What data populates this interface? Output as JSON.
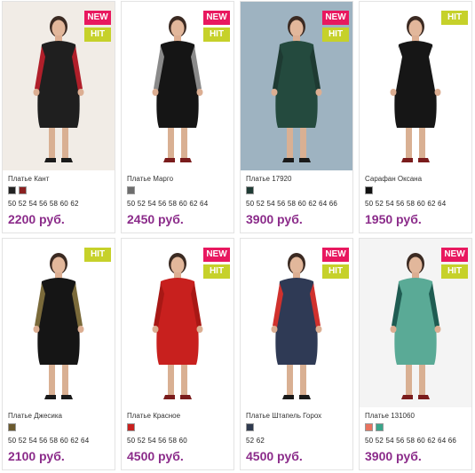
{
  "accent_price_color": "#8b2b8a",
  "badge_colors": {
    "new": "#e8185f",
    "hit": "#c6d12a"
  },
  "products": [
    {
      "name": "Платье Кант",
      "badges": [
        "NEW",
        "HIT"
      ],
      "swatches": [
        "#222222",
        "#8a2020"
      ],
      "sizes": "50 52 54 56 58 60 62",
      "price": "2200 руб.",
      "dress": "#1f1f1f",
      "accent": "#b01f2a",
      "bg": "#f1ece6"
    },
    {
      "name": "Платье Марго",
      "badges": [
        "NEW",
        "HIT"
      ],
      "swatches": [
        "#6d6d6d"
      ],
      "sizes": "50 52 54 56 58 60 62 64",
      "price": "2450 руб.",
      "dress": "#151515",
      "accent": "#8a8a8a",
      "bg": "#ffffff"
    },
    {
      "name": "Платье 17920",
      "badges": [
        "NEW",
        "HIT"
      ],
      "swatches": [
        "#1f3b34"
      ],
      "sizes": "50 52 54 56 58 60 62 64 66",
      "price": "3900 руб.",
      "dress": "#244a3e",
      "accent": "#1e3a32",
      "bg": "#9eb3c1"
    },
    {
      "name": "Сарафан Оксана",
      "badges": [
        "HIT"
      ],
      "swatches": [
        "#111111"
      ],
      "sizes": "50 52 54 56 58 60 62 64",
      "price": "1950 руб.",
      "dress": "#161616",
      "accent": "#ffffff",
      "bg": "#ffffff"
    },
    {
      "name": "Платье Джесика",
      "badges": [
        "HIT"
      ],
      "swatches": [
        "#6b5a2f"
      ],
      "sizes": "50 52 54 56 58 60 62 64",
      "price": "2100 руб.",
      "dress": "#151515",
      "accent": "#7a6a3a",
      "bg": "#ffffff"
    },
    {
      "name": "Платье Красное",
      "badges": [
        "NEW",
        "HIT"
      ],
      "swatches": [
        "#c8201e"
      ],
      "sizes": "50 52 54 56 58 60",
      "price": "4500 руб.",
      "dress": "#c8201e",
      "accent": "#a81815",
      "bg": "#ffffff"
    },
    {
      "name": "Платье Штапель Горох",
      "badges": [
        "NEW",
        "HIT"
      ],
      "swatches": [
        "#2f3a4f"
      ],
      "sizes": "52 62",
      "price": "4500 руб.",
      "dress": "#2f3a55",
      "accent": "#d0312d",
      "bg": "#ffffff"
    },
    {
      "name": "Платье 131060",
      "badges": [
        "NEW",
        "HIT"
      ],
      "swatches": [
        "#e8735f",
        "#3aa58a"
      ],
      "sizes": "50 52 54 56 58 60 62 64 66",
      "price": "3900 руб.",
      "dress": "#5aaa96",
      "accent": "#1f5c52",
      "bg": "#f4f4f4"
    }
  ]
}
